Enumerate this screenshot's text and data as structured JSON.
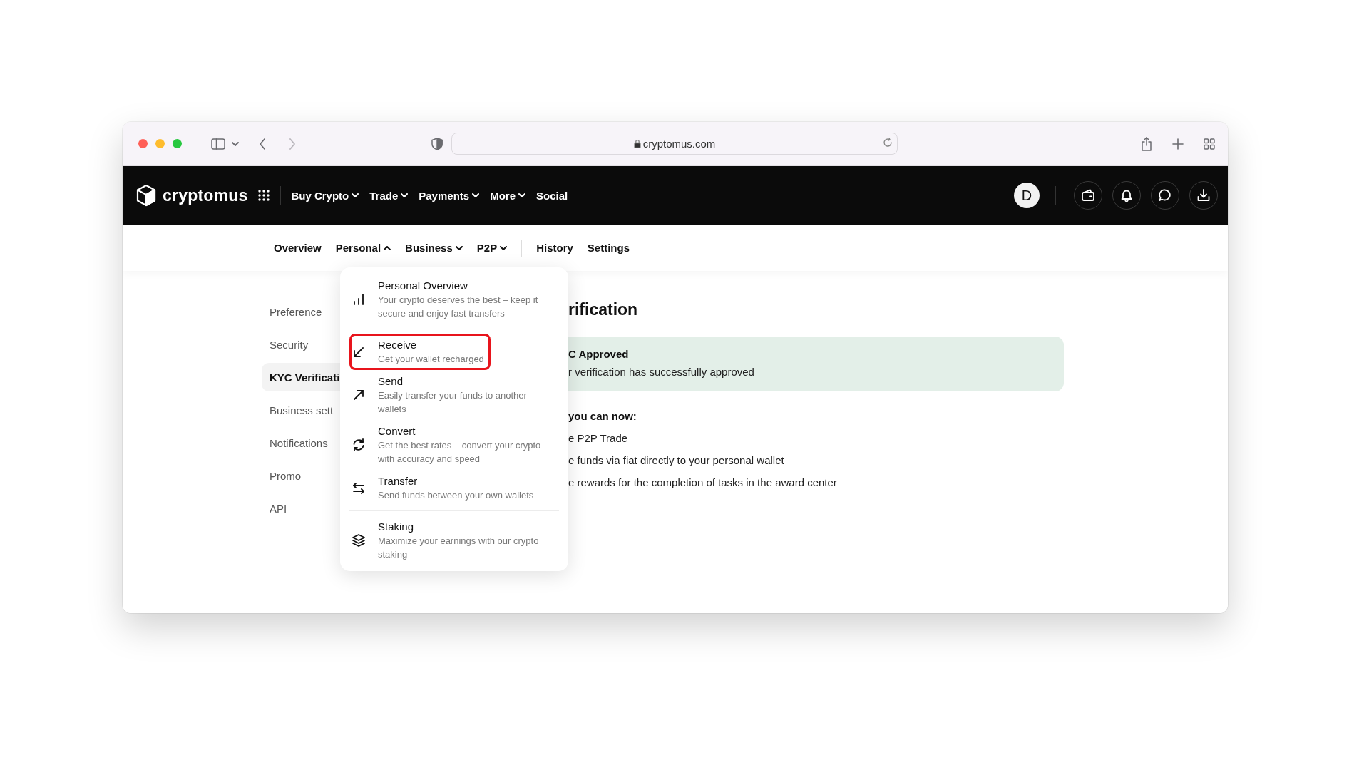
{
  "browser": {
    "url": "cryptomus.com"
  },
  "header": {
    "logo": "cryptomus",
    "nav": [
      {
        "label": "Buy Crypto",
        "kind": "menu"
      },
      {
        "label": "Trade",
        "kind": "menu"
      },
      {
        "label": "Payments",
        "kind": "menu"
      },
      {
        "label": "More",
        "kind": "menu"
      },
      {
        "label": "Social",
        "kind": "link"
      }
    ],
    "avatar": "D"
  },
  "subnav": {
    "groups": [
      [
        {
          "label": "Overview",
          "kind": "link"
        },
        {
          "label": "Personal",
          "kind": "menu",
          "expanded": true
        },
        {
          "label": "Business",
          "kind": "menu",
          "expanded": false
        },
        {
          "label": "P2P",
          "kind": "menu",
          "expanded": false
        }
      ],
      [
        {
          "label": "History",
          "kind": "link"
        },
        {
          "label": "Settings",
          "kind": "link"
        }
      ]
    ]
  },
  "sidebar": {
    "items": [
      {
        "label": "Preference",
        "selected": false
      },
      {
        "label": "Security",
        "selected": false
      },
      {
        "label": "KYC Verificati",
        "selected": true
      },
      {
        "label": "Business sett",
        "selected": false
      },
      {
        "label": "Notifications",
        "selected": false
      },
      {
        "label": "Promo",
        "selected": false
      },
      {
        "label": "API",
        "selected": false
      }
    ]
  },
  "dropdown": {
    "sections": [
      [
        {
          "kind": "chart",
          "title": "Personal Overview",
          "description": "Your crypto deserves the best – keep it secure and enjoy fast transfers",
          "highlighted": false
        }
      ],
      [
        {
          "kind": "receive",
          "title": "Receive",
          "description": "Get your wallet recharged",
          "highlighted": true
        },
        {
          "kind": "send",
          "title": "Send",
          "description": "Easily transfer your funds to another wallets",
          "highlighted": false
        },
        {
          "kind": "convert",
          "title": "Convert",
          "description": "Get the best rates – convert your crypto with accuracy and speed",
          "highlighted": false
        },
        {
          "kind": "transfer",
          "title": "Transfer",
          "description": "Send funds between your own wallets",
          "highlighted": false
        }
      ],
      [
        {
          "kind": "staking",
          "title": "Staking",
          "description": "Maximize your earnings with our crypto staking",
          "highlighted": false
        }
      ]
    ]
  },
  "content": {
    "heading": "rification",
    "notice": {
      "title": "C Approved",
      "text": "r verification has successfully approved"
    },
    "intro": "you can now:",
    "list": [
      "e P2P Trade",
      "e funds via fiat directly to your personal wallet",
      "e rewards for the completion of tasks in the award center"
    ]
  }
}
